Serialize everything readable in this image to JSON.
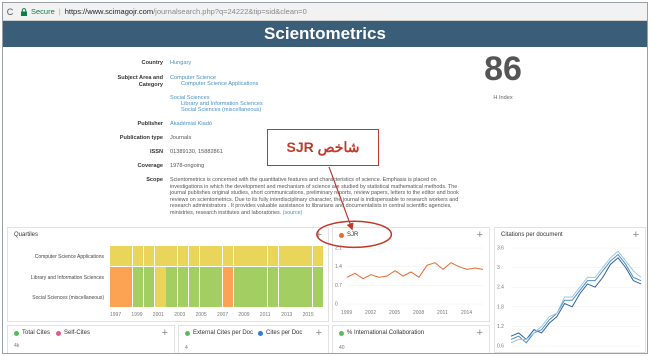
{
  "browser": {
    "reload_icon": "reload-icon",
    "secure_label": "Secure",
    "url_host": "https://www.scimagojr.com",
    "url_path": "/journalsearch.php?q=24222&tip=sid&clean=0"
  },
  "page": {
    "title": "Scientometrics"
  },
  "info": {
    "country_label": "Country",
    "country_value": "Hungary",
    "subject_label": "Subject Area and Category",
    "subject_1": "Computer Science",
    "subject_1_cat": "Computer Science Applications",
    "subject_2": "Social Sciences",
    "subject_2_cat_1": "Library and Information Sciences",
    "subject_2_cat_2": "Social Sciences (miscellaneous)",
    "publisher_label": "Publisher",
    "publisher_value": "Akadémiai Kiadó",
    "pubtype_label": "Publication type",
    "pubtype_value": "Journals",
    "issn_label": "ISSN",
    "issn_value": "01389130, 15882861",
    "coverage_label": "Coverage",
    "coverage_value": "1978-ongoing",
    "scope_label": "Scope",
    "scope_text": "Scientometrics is concerned with the quantitative features and characteristics of science. Emphasis is placed on investigations in which the development and mechanism of science are studied by statistical mathematical methods. The journal publishes original studies, short communications, preliminary reports, review papers, letters to the editor and book reviews on scientometrics. Due to its fully interdisciplinary character, the journal is indispensable to research workers and research administrators . It provides valuable assistance to librarians and documentalists in central scientific agencies, ministries, research institutes and laboratories.",
    "scope_source": "(source)"
  },
  "hindex": {
    "value": "86",
    "label": "H Index"
  },
  "callout": {
    "text": "شاخص SJR"
  },
  "quartiles": {
    "title": "Quartiles",
    "rows": [
      "Computer Science Applications",
      "Library and Information Sciences",
      "Social Sciences (miscellaneous)"
    ],
    "years": [
      "1997",
      "1999",
      "2001",
      "2003",
      "2005",
      "2007",
      "2009",
      "2011",
      "2013",
      "2015"
    ],
    "grid": [
      [
        2,
        2,
        2,
        2,
        2,
        2,
        2,
        2,
        2,
        2,
        2,
        2,
        2,
        2,
        2,
        2,
        2,
        2,
        2
      ],
      [
        3,
        3,
        1,
        1,
        2,
        1,
        1,
        1,
        1,
        1,
        3,
        1,
        1,
        1,
        1,
        1,
        1,
        1,
        1
      ],
      [
        3,
        3,
        1,
        1,
        2,
        1,
        1,
        1,
        1,
        1,
        3,
        1,
        1,
        1,
        1,
        1,
        1,
        1,
        1
      ]
    ],
    "colors": {
      "q1": "#a3cf62",
      "q2": "#e8d559",
      "q3": "#fba353",
      "q4": "#dd5a4e"
    }
  },
  "sjr": {
    "title": "SJR",
    "dot_color": "#e66a2c",
    "plus": "+",
    "y_ticks": [
      "2.1",
      "1.4",
      "0.7",
      "0"
    ],
    "x_ticks": [
      "1999",
      "2002",
      "2005",
      "2008",
      "2011",
      "2014"
    ]
  },
  "citations": {
    "title": "Citations per document",
    "plus": "+",
    "y_ticks": [
      "3.6",
      "3",
      "2.4",
      "1.8",
      "1.2",
      "0.6"
    ]
  },
  "bottom": {
    "total_cites_label": "Total Cites",
    "self_cites_label": "Self-Cites",
    "total_color": "#5cb85c",
    "self_color": "#e05c8a",
    "total_tick": "4k",
    "external_label": "External Cites per Doc",
    "cites_per_doc_label": "Cites per Doc",
    "external_color": "#5cb85c",
    "cpd_color": "#2e7dd6",
    "external_tick": "4",
    "intl_label": "% International Collaboration",
    "intl_color": "#5cb85c",
    "intl_tick": "40",
    "plus": "+"
  },
  "chart_data": [
    {
      "type": "line",
      "title": "SJR",
      "x": [
        1999,
        2000,
        2001,
        2002,
        2003,
        2004,
        2005,
        2006,
        2007,
        2008,
        2009,
        2010,
        2011,
        2012,
        2013,
        2014,
        2015,
        2016
      ],
      "series": [
        {
          "values": [
            1.0,
            1.15,
            0.95,
            1.1,
            1.0,
            1.05,
            1.25,
            1.05,
            1.2,
            1.0,
            1.45,
            1.55,
            1.3,
            1.55,
            1.4,
            1.3,
            1.35,
            1.3
          ]
        }
      ],
      "ylim": [
        0,
        2.1
      ]
    },
    {
      "type": "line",
      "title": "Citations per document",
      "x": [
        1999,
        2000,
        2001,
        2002,
        2003,
        2004,
        2005,
        2006,
        2007,
        2008,
        2009,
        2010,
        2011,
        2012,
        2013,
        2014,
        2015,
        2016
      ],
      "series": [
        {
          "values": [
            0.9,
            1.0,
            0.8,
            1.1,
            1.0,
            1.3,
            1.5,
            1.9,
            1.8,
            2.2,
            2.5,
            2.4,
            2.7,
            3.1,
            3.3,
            3.0,
            2.6,
            2.5
          ]
        },
        {
          "values": [
            0.8,
            0.9,
            0.7,
            1.0,
            1.1,
            1.4,
            1.6,
            2.0,
            2.0,
            2.3,
            2.6,
            2.6,
            2.9,
            3.2,
            3.4,
            3.1,
            2.7,
            2.6
          ]
        },
        {
          "values": [
            0.7,
            0.8,
            0.8,
            1.0,
            1.2,
            1.5,
            1.6,
            2.1,
            2.1,
            2.4,
            2.7,
            2.7,
            3.0,
            3.3,
            3.5,
            3.2,
            2.9,
            2.7
          ]
        }
      ],
      "ylim": [
        0.6,
        3.6
      ]
    }
  ]
}
